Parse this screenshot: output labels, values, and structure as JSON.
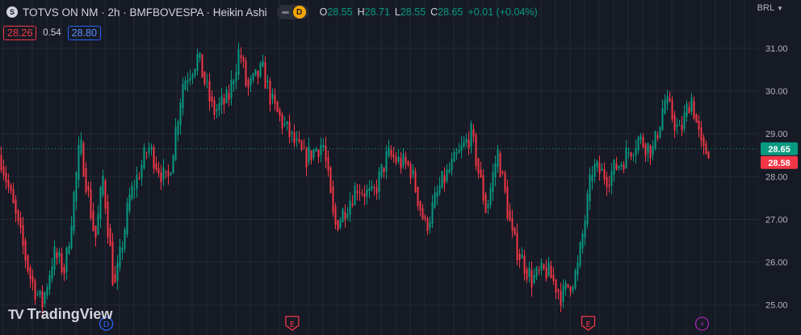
{
  "header": {
    "title": "TOTVS ON NM · 2h · BMFBOVESPA · Heikin Ashi",
    "badge_letter": "D",
    "ohlc": {
      "o_label": "O",
      "o": "28.55",
      "h_label": "H",
      "h": "28.71",
      "l_label": "L",
      "l": "28.55",
      "c_label": "C",
      "c": "28.65",
      "change": "+0.01 (+0.04%)"
    }
  },
  "prices": {
    "sell": "28.26",
    "spread": "0.54",
    "buy": "28.80"
  },
  "currency": "BRL",
  "logo_text": "TradingView",
  "colors": {
    "up": "#089981",
    "down": "#f23645",
    "background": "#161a25",
    "grid": "#242833"
  },
  "chart_data": {
    "type": "candlestick",
    "title": "",
    "yticks": [
      31.0,
      30.0,
      29.0,
      28.0,
      27.0,
      26.0,
      25.0
    ],
    "ytick_labels": [
      "31.00",
      "30.00",
      "29.00",
      "28.00",
      "27.00",
      "26.00",
      "25.00"
    ],
    "ylim": [
      24.75,
      31.6
    ],
    "last_price": "28.65",
    "prev_close": "28.58",
    "price_line": 28.65,
    "grid": true,
    "events": [
      {
        "label": "D",
        "position": 0.14,
        "kind": "dividend"
      },
      {
        "label": "E",
        "position": 0.385,
        "kind": "earnings"
      },
      {
        "label": "E",
        "position": 0.775,
        "kind": "earnings"
      },
      {
        "label": "⚡",
        "position": 0.925,
        "kind": "split"
      }
    ],
    "path": [
      [
        0,
        28.5
      ],
      [
        0.04,
        25.6
      ],
      [
        0.055,
        25.0
      ],
      [
        0.07,
        26.2
      ],
      [
        0.085,
        25.8
      ],
      [
        0.105,
        28.8
      ],
      [
        0.125,
        26.5
      ],
      [
        0.135,
        28.0
      ],
      [
        0.15,
        25.3
      ],
      [
        0.17,
        27.5
      ],
      [
        0.195,
        28.7
      ],
      [
        0.22,
        27.8
      ],
      [
        0.24,
        30.2
      ],
      [
        0.26,
        30.8
      ],
      [
        0.28,
        29.5
      ],
      [
        0.3,
        29.8
      ],
      [
        0.315,
        31.0
      ],
      [
        0.325,
        30.0
      ],
      [
        0.345,
        30.5
      ],
      [
        0.36,
        29.6
      ],
      [
        0.38,
        29.0
      ],
      [
        0.4,
        28.4
      ],
      [
        0.425,
        28.8
      ],
      [
        0.44,
        26.8
      ],
      [
        0.47,
        27.8
      ],
      [
        0.49,
        27.5
      ],
      [
        0.51,
        28.5
      ],
      [
        0.54,
        28.2
      ],
      [
        0.56,
        26.8
      ],
      [
        0.58,
        27.8
      ],
      [
        0.6,
        28.4
      ],
      [
        0.62,
        29.0
      ],
      [
        0.64,
        27.2
      ],
      [
        0.655,
        28.6
      ],
      [
        0.675,
        26.5
      ],
      [
        0.7,
        25.6
      ],
      [
        0.72,
        25.8
      ],
      [
        0.74,
        25.2
      ],
      [
        0.76,
        25.8
      ],
      [
        0.78,
        28.2
      ],
      [
        0.8,
        28.0
      ],
      [
        0.82,
        28.4
      ],
      [
        0.84,
        28.9
      ],
      [
        0.86,
        28.6
      ],
      [
        0.875,
        29.8
      ],
      [
        0.895,
        29.0
      ],
      [
        0.91,
        29.9
      ],
      [
        0.925,
        28.5
      ],
      [
        0.933,
        28.65
      ]
    ]
  }
}
